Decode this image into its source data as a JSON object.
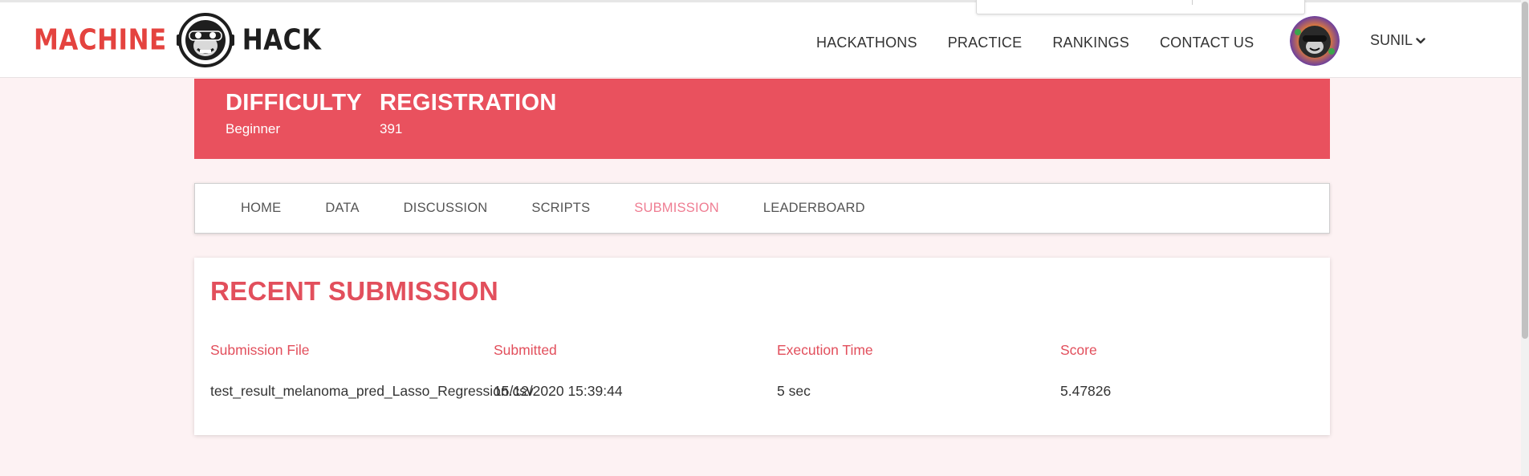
{
  "header": {
    "logo": {
      "word_left": "MACHINE",
      "word_right": "HACK",
      "mascot": "monkey-astronaut-logo"
    },
    "nav": [
      "HACKATHONS",
      "PRACTICE",
      "RANKINGS",
      "CONTACT US"
    ],
    "user": {
      "name": "SUNIL",
      "caret": "chevron-down-icon"
    }
  },
  "banner": {
    "stats": [
      {
        "label": "DIFFICULTY",
        "value": "Beginner"
      },
      {
        "label": "REGISTRATION",
        "value": "391"
      }
    ]
  },
  "tabs": {
    "items": [
      "HOME",
      "DATA",
      "DISCUSSION",
      "SCRIPTS",
      "SUBMISSION",
      "LEADERBOARD"
    ],
    "active": "SUBMISSION"
  },
  "submissions": {
    "title": "RECENT SUBMISSION",
    "columns": [
      "Submission File",
      "Submitted",
      "Execution Time",
      "Score"
    ],
    "rows": [
      [
        "test_result_melanoma_pred_Lasso_Regression.csv",
        "15/12/2020 15:39:44",
        "5 sec",
        "5.47826"
      ]
    ]
  },
  "colors": {
    "brand_red": "#e4433f",
    "banner": "#e9515e",
    "heading_red": "#e24f5c",
    "active_tab": "#ef7d92",
    "page_bg": "#fdf2f3"
  }
}
